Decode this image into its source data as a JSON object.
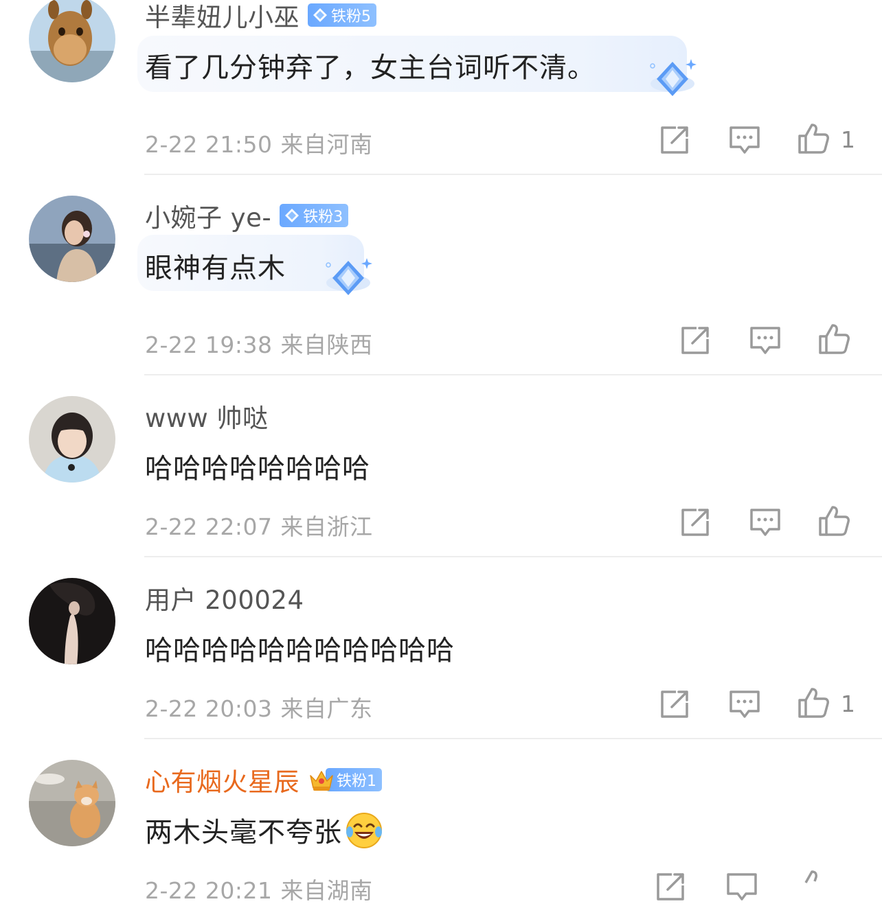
{
  "comments": [
    {
      "username": "半辈妞儿小巫",
      "badge": "铁粉5",
      "text": "看了几分钟弃了，女主台词听不清。",
      "date": "2-22 21:50",
      "location": "来自河南",
      "likes": "1",
      "avatar_icon": "giraffe-avatar"
    },
    {
      "username": "小婉子 ye-",
      "badge": "铁粉3",
      "text": "眼神有点木",
      "date": "2-22 19:38",
      "location": "来自陕西",
      "likes": "",
      "avatar_icon": "woman-seaside-avatar"
    },
    {
      "username": "www 帅哒",
      "badge": "",
      "text": "哈哈哈哈哈哈哈哈",
      "date": "2-22 22:07",
      "location": "来自浙江",
      "likes": "",
      "avatar_icon": "young-man-avatar"
    },
    {
      "username": "用户 200024",
      "badge": "",
      "text": "哈哈哈哈哈哈哈哈哈哈哈",
      "date": "2-22 20:03",
      "location": "来自广东",
      "likes": "1",
      "avatar_icon": "dark-silhouette-avatar"
    },
    {
      "username": "心有烟火星辰",
      "badge": "铁粉1",
      "text": "两木头毫不夸张",
      "date": "2-22 20:21",
      "location": "来自湖南",
      "likes": "",
      "avatar_icon": "cat-avatar"
    }
  ],
  "icons": {
    "repost": "share-square-icon",
    "comment": "comment-bubble-icon",
    "like": "thumbs-up-icon"
  },
  "colors": {
    "username": "#555555",
    "vip_username": "#e8691d",
    "badge": "#6aa8ff",
    "meta": "#a7a7a7",
    "text": "#222222"
  }
}
